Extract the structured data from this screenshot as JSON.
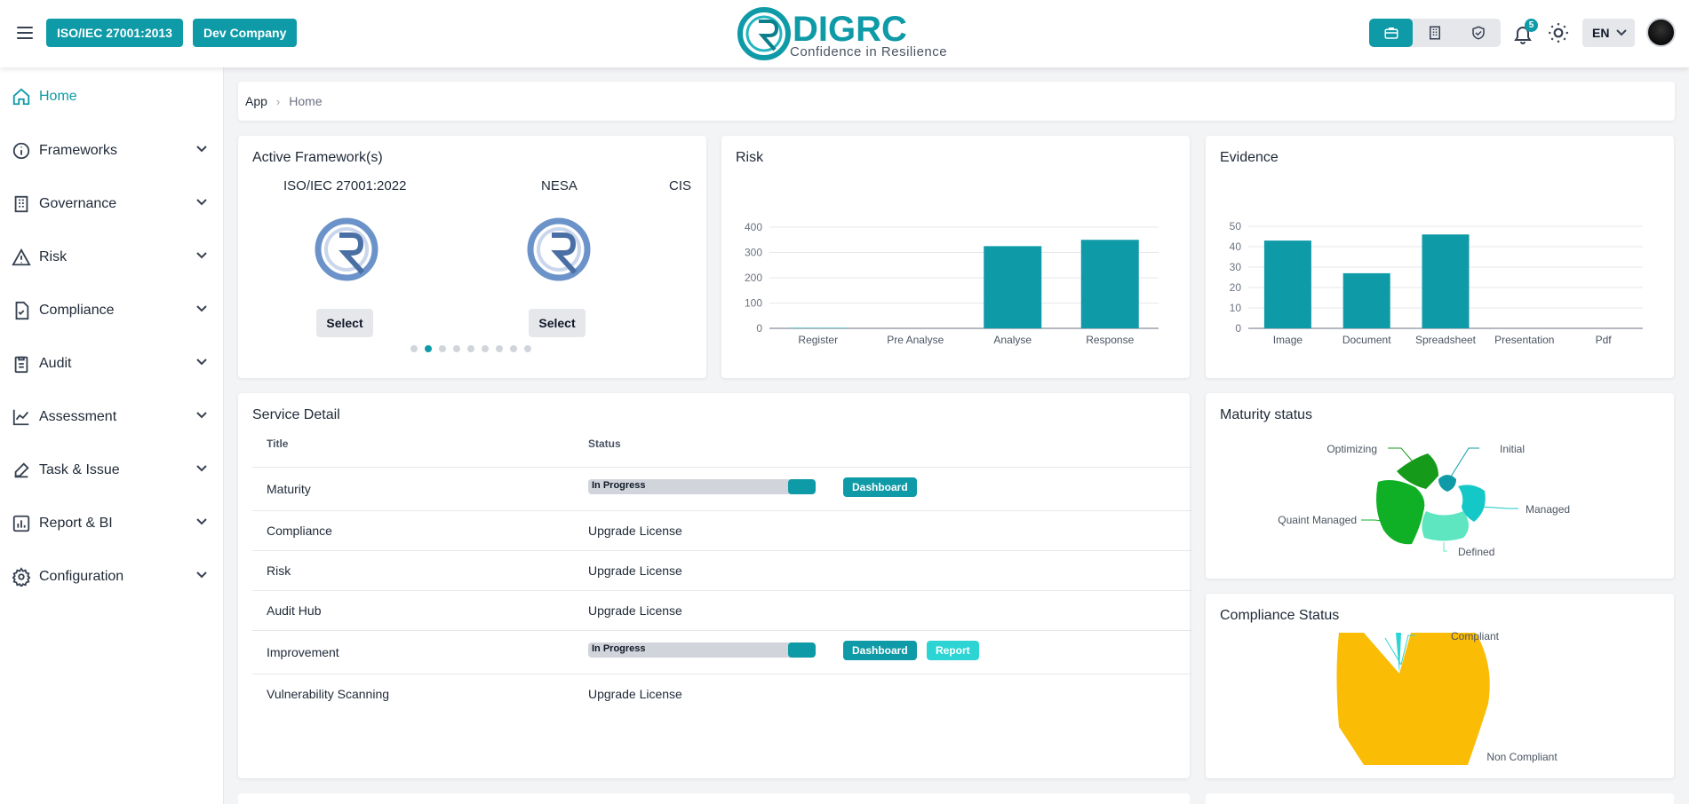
{
  "header": {
    "framework_chip": "ISO/IEC 27001:2013",
    "company_chip": "Dev Company",
    "logo_text": "DIGRC",
    "logo_tagline": "Confidence in Resilience",
    "notification_count": "5",
    "language": "EN",
    "icons": [
      "menu-icon",
      "briefcase-icon",
      "building-icon",
      "shield-check-icon",
      "bell-icon",
      "sun-icon",
      "chevron-down-icon",
      "avatar"
    ]
  },
  "sidebar": {
    "items": [
      {
        "label": "Home",
        "icon": "home-icon"
      },
      {
        "label": "Frameworks",
        "icon": "info-icon"
      },
      {
        "label": "Governance",
        "icon": "building-icon"
      },
      {
        "label": "Risk",
        "icon": "warning-icon"
      },
      {
        "label": "Compliance",
        "icon": "file-check-icon"
      },
      {
        "label": "Audit",
        "icon": "clipboard-icon"
      },
      {
        "label": "Assessment",
        "icon": "chart-line-icon"
      },
      {
        "label": "Task & Issue",
        "icon": "edit-icon"
      },
      {
        "label": "Report & BI",
        "icon": "bar-chart-icon"
      },
      {
        "label": "Configuration",
        "icon": "gear-icon"
      }
    ]
  },
  "breadcrumb": {
    "root": "App",
    "current": "Home"
  },
  "frameworks": {
    "title": "Active Framework(s)",
    "items": [
      {
        "name": "ISO/IEC 27001:2022",
        "button": "Select"
      },
      {
        "name": "NESA",
        "button": "Select"
      },
      {
        "name": "CIS"
      }
    ],
    "dot_count": 9,
    "active_dot": 1
  },
  "risk": {
    "title": "Risk",
    "chart_data": {
      "type": "bar",
      "categories": [
        "Register",
        "Pre Analyse",
        "Analyse",
        "Response"
      ],
      "values": [
        2,
        0,
        325,
        350
      ],
      "yticks": [
        0,
        100,
        200,
        300,
        400
      ],
      "ylim": [
        0,
        400
      ],
      "color": "#0e9aa7"
    }
  },
  "evidence": {
    "title": "Evidence",
    "chart_data": {
      "type": "bar",
      "categories": [
        "Image",
        "Document",
        "Spreadsheet",
        "Presentation",
        "Pdf"
      ],
      "values": [
        43,
        27,
        46,
        0,
        0
      ],
      "yticks": [
        0,
        10,
        20,
        30,
        40,
        50
      ],
      "ylim": [
        0,
        50
      ],
      "color": "#0e9aa7"
    }
  },
  "service": {
    "title": "Service Detail",
    "col_title": "Title",
    "col_status": "Status",
    "rows": [
      {
        "title": "Maturity",
        "status": "In Progress",
        "progress": 0.88,
        "buttons": [
          "Dashboard"
        ]
      },
      {
        "title": "Compliance",
        "status": "Upgrade License"
      },
      {
        "title": "Risk",
        "status": "Upgrade License"
      },
      {
        "title": "Audit Hub",
        "status": "Upgrade License"
      },
      {
        "title": "Improvement",
        "status": "In Progress",
        "progress": 0.88,
        "buttons": [
          "Dashboard",
          "Report"
        ]
      },
      {
        "title": "Vulnerability Scanning",
        "status": "Upgrade License"
      }
    ]
  },
  "maturity": {
    "title": "Maturity status",
    "chart_data": {
      "type": "pie",
      "labels": [
        "Initial",
        "Managed",
        "Defined",
        "Quaint Managed",
        "Optimizing"
      ],
      "colors": [
        "#0e9aa7",
        "#14c8c8",
        "#5ee6c0",
        "#10b026",
        "#159a1a"
      ]
    }
  },
  "compliance": {
    "title": "Compliance Status",
    "chart_data": {
      "type": "pie",
      "labels": [
        "Compliant",
        "Non Compliant"
      ],
      "values": [
        2,
        98
      ],
      "colors": [
        "#2dd4d4",
        "#fbbc05"
      ]
    }
  }
}
